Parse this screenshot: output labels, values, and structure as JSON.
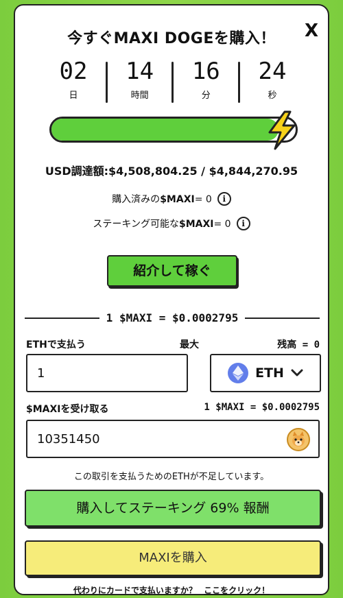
{
  "header": {
    "title": "今すぐMAXI DOGEを購入！",
    "close": "X"
  },
  "countdown": [
    {
      "value": "02",
      "label": "日"
    },
    {
      "value": "14",
      "label": "時間"
    },
    {
      "value": "16",
      "label": "分"
    },
    {
      "value": "24",
      "label": "秒"
    }
  ],
  "progress": {
    "fraction": 0.93
  },
  "raised": {
    "text": "USD調達額:$4,508,804.25 / $4,844,270.95"
  },
  "purchased": {
    "label": "購入済みの",
    "token": "$MAXI",
    "value": "= 0"
  },
  "stakeable": {
    "label": "ステーキング可能な",
    "token": "$MAXI",
    "value": "= 0"
  },
  "info_icon": "i",
  "referral_button": "紹介して稼ぐ",
  "rate": "1 $MAXI = $0.0002795",
  "pay": {
    "label": "ETHで支払う",
    "max": "最大",
    "balance": "残高 = 0",
    "value": "1",
    "currency": "ETH"
  },
  "receive": {
    "label": "$MAXIを受け取る",
    "rate": "1 $MAXI = $0.0002795",
    "value": "10351450"
  },
  "warning": "この取引を支払うためのETHが不足しています。",
  "stake_button": "購入してステーキング 69% 報酬",
  "buy_button": "MAXIを購入",
  "card_pay": {
    "question": "代わりにカードで支払いますか？",
    "link": "ここをクリック！"
  },
  "colors": {
    "accent_green": "#5fcf3c",
    "stake_green": "#7fe06a",
    "buy_yellow": "#f6ec7a",
    "eth_blue": "#627eea"
  }
}
